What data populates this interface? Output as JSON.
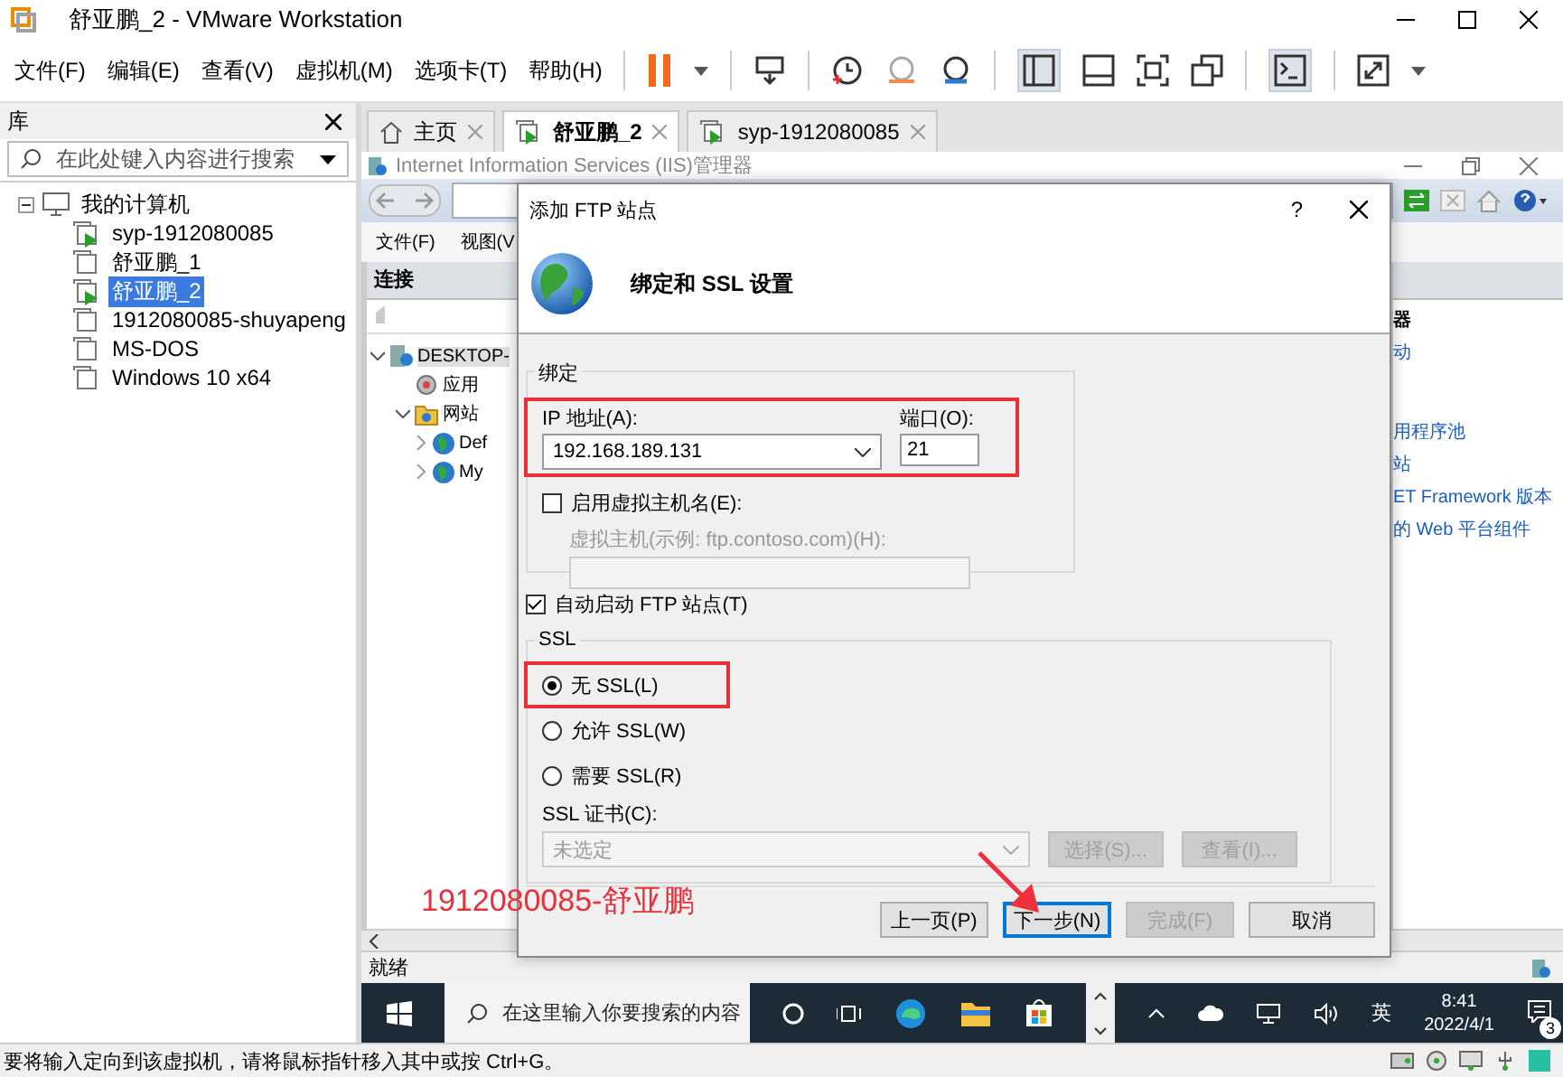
{
  "window": {
    "title": "舒亚鹏_2 - VMware Workstation"
  },
  "menu": [
    "文件(F)",
    "编辑(E)",
    "查看(V)",
    "虚拟机(M)",
    "选项卡(T)",
    "帮助(H)"
  ],
  "library": {
    "title": "库",
    "search": {
      "placeholder": "在此处键入内容进行搜索"
    },
    "tree": [
      {
        "label": "我的计算机",
        "expanded": true,
        "children": [
          {
            "label": "syp-1912080085",
            "running": true,
            "selected": false
          },
          {
            "label": "舒亚鹏_1",
            "running": false,
            "selected": false
          },
          {
            "label": "舒亚鹏_2",
            "running": true,
            "selected": true
          },
          {
            "label": "1912080085-shuyapeng",
            "running": false,
            "selected": false
          },
          {
            "label": "MS-DOS",
            "running": false,
            "selected": false
          },
          {
            "label": "Windows 10 x64",
            "running": false,
            "selected": false
          }
        ]
      }
    ]
  },
  "tabs": [
    {
      "label": "主页",
      "kind": "home",
      "selected": false
    },
    {
      "label": "舒亚鹏_2",
      "kind": "vm",
      "selected": true
    },
    {
      "label": "syp-1912080085",
      "kind": "vm",
      "selected": false
    }
  ],
  "iis": {
    "title": "Internet Information Services (IIS)管理器",
    "menu": [
      "文件(F)",
      "视图(V"
    ],
    "connections": {
      "title": "连接",
      "tree": [
        {
          "label": "DESKTOP-",
          "kind": "server",
          "expanded": true,
          "selected": true,
          "children": [
            {
              "label": "应用",
              "kind": "pool",
              "selected": false
            },
            {
              "label": "网站",
              "kind": "sites",
              "expanded": true,
              "selected": false,
              "children": [
                {
                  "label": "Def",
                  "kind": "site",
                  "expanded": false,
                  "selected": false
                },
                {
                  "label": "My",
                  "kind": "site",
                  "expanded": false,
                  "selected": false
                }
              ]
            }
          ]
        }
      ]
    },
    "actions": [
      {
        "label": "器",
        "kind": "header"
      },
      {
        "label": "动",
        "kind": "link"
      },
      {
        "label": "用程序池",
        "kind": "link"
      },
      {
        "label": "站",
        "kind": "link"
      },
      {
        "label": "ET Framework 版本",
        "kind": "link"
      },
      {
        "label": "的 Web 平台组件",
        "kind": "link"
      }
    ],
    "status": "就绪"
  },
  "dialog": {
    "title": "添加 FTP 站点",
    "help": "?",
    "heading": "绑定和 SSL 设置",
    "binding": {
      "title": "绑定",
      "highlighted": true,
      "ip_label": "IP 地址(A):",
      "ip": "192.168.189.131",
      "port_label": "端口(O):",
      "port": "21",
      "virtual_host": {
        "label": "启用虚拟主机名(E):",
        "checked": false
      },
      "host_label": "虚拟主机(示例: ftp.contoso.com)(H):"
    },
    "autostart": {
      "label": "自动启动 FTP 站点(T)",
      "checked": true
    },
    "ssl": {
      "title": "SSL",
      "options": [
        {
          "label": "无 SSL(L)",
          "selected": true,
          "highlighted": true
        },
        {
          "label": "允许 SSL(W)",
          "selected": false,
          "highlighted": false
        },
        {
          "label": "需要 SSL(R)",
          "selected": false,
          "highlighted": false
        }
      ],
      "cert_label": "SSL 证书(C):",
      "cert_value": "未选定",
      "cert_disabled": true,
      "buttons": [
        {
          "label": "选择(S)...",
          "disabled": true
        },
        {
          "label": "查看(I)...",
          "disabled": true
        }
      ]
    },
    "buttons": [
      {
        "label": "上一页(P)",
        "disabled": false,
        "focused": false
      },
      {
        "label": "下一步(N)",
        "disabled": false,
        "focused": true
      },
      {
        "label": "完成(F)",
        "disabled": true,
        "focused": false
      },
      {
        "label": "取消",
        "disabled": false,
        "focused": false
      }
    ]
  },
  "annotation": "1912080085-舒亚鹏",
  "taskbar": {
    "search_placeholder": "在这里输入你要搜索的内容",
    "language": "英",
    "time": "8:41",
    "date": "2022/4/1",
    "badge": "3"
  },
  "status_bar": "要将输入定向到该虚拟机，请将鼠标指针移入其中或按 Ctrl+G。"
}
